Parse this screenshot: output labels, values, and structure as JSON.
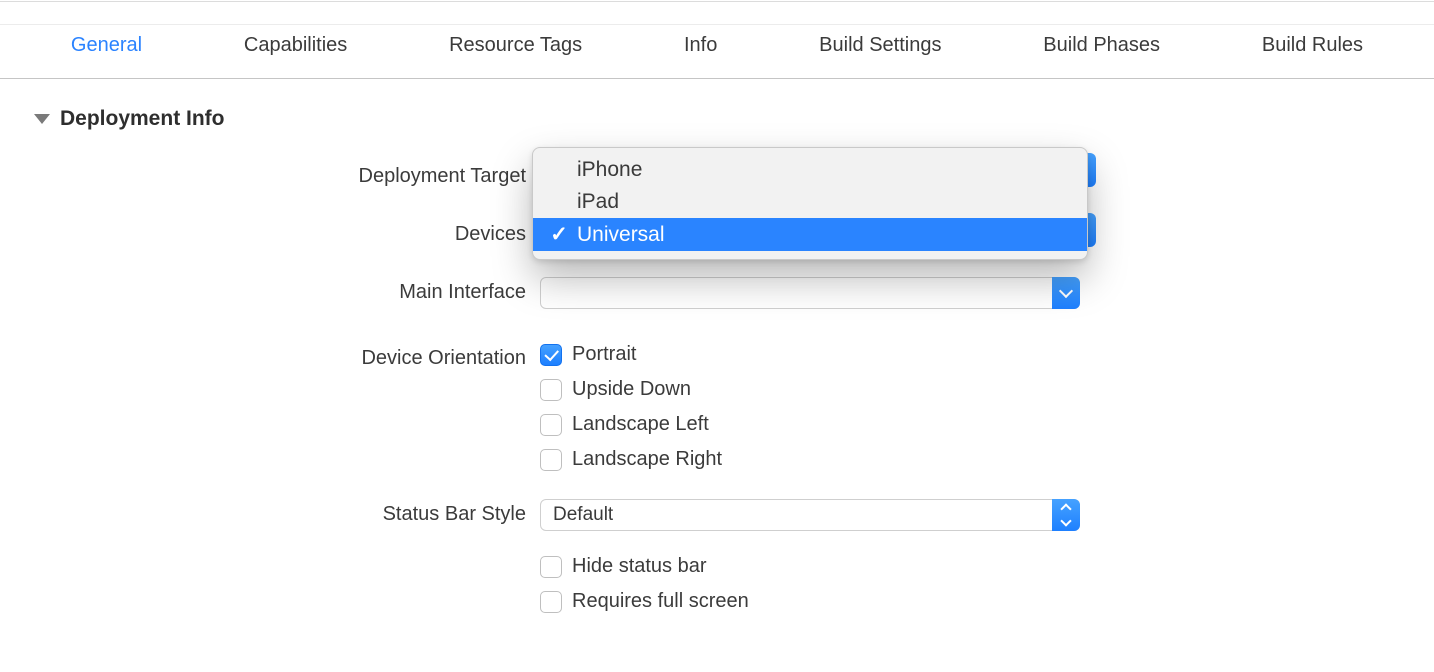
{
  "tabs": {
    "items": [
      {
        "label": "General",
        "active": true
      },
      {
        "label": "Capabilities",
        "active": false
      },
      {
        "label": "Resource Tags",
        "active": false
      },
      {
        "label": "Info",
        "active": false
      },
      {
        "label": "Build Settings",
        "active": false
      },
      {
        "label": "Build Phases",
        "active": false
      },
      {
        "label": "Build Rules",
        "active": false
      }
    ]
  },
  "section": {
    "title": "Deployment Info"
  },
  "fields": {
    "deployment_target": {
      "label": "Deployment Target"
    },
    "devices": {
      "label": "Devices",
      "menu": {
        "items": [
          {
            "label": "iPhone",
            "selected": false
          },
          {
            "label": "iPad",
            "selected": false
          },
          {
            "label": "Universal",
            "selected": true
          }
        ]
      }
    },
    "main_interface": {
      "label": "Main Interface",
      "value": ""
    },
    "device_orientation": {
      "label": "Device Orientation",
      "options": [
        {
          "label": "Portrait",
          "checked": true
        },
        {
          "label": "Upside Down",
          "checked": false
        },
        {
          "label": "Landscape Left",
          "checked": false
        },
        {
          "label": "Landscape Right",
          "checked": false
        }
      ]
    },
    "status_bar_style": {
      "label": "Status Bar Style",
      "value": "Default"
    },
    "extra_checks": [
      {
        "label": "Hide status bar",
        "checked": false
      },
      {
        "label": "Requires full screen",
        "checked": false
      }
    ]
  }
}
